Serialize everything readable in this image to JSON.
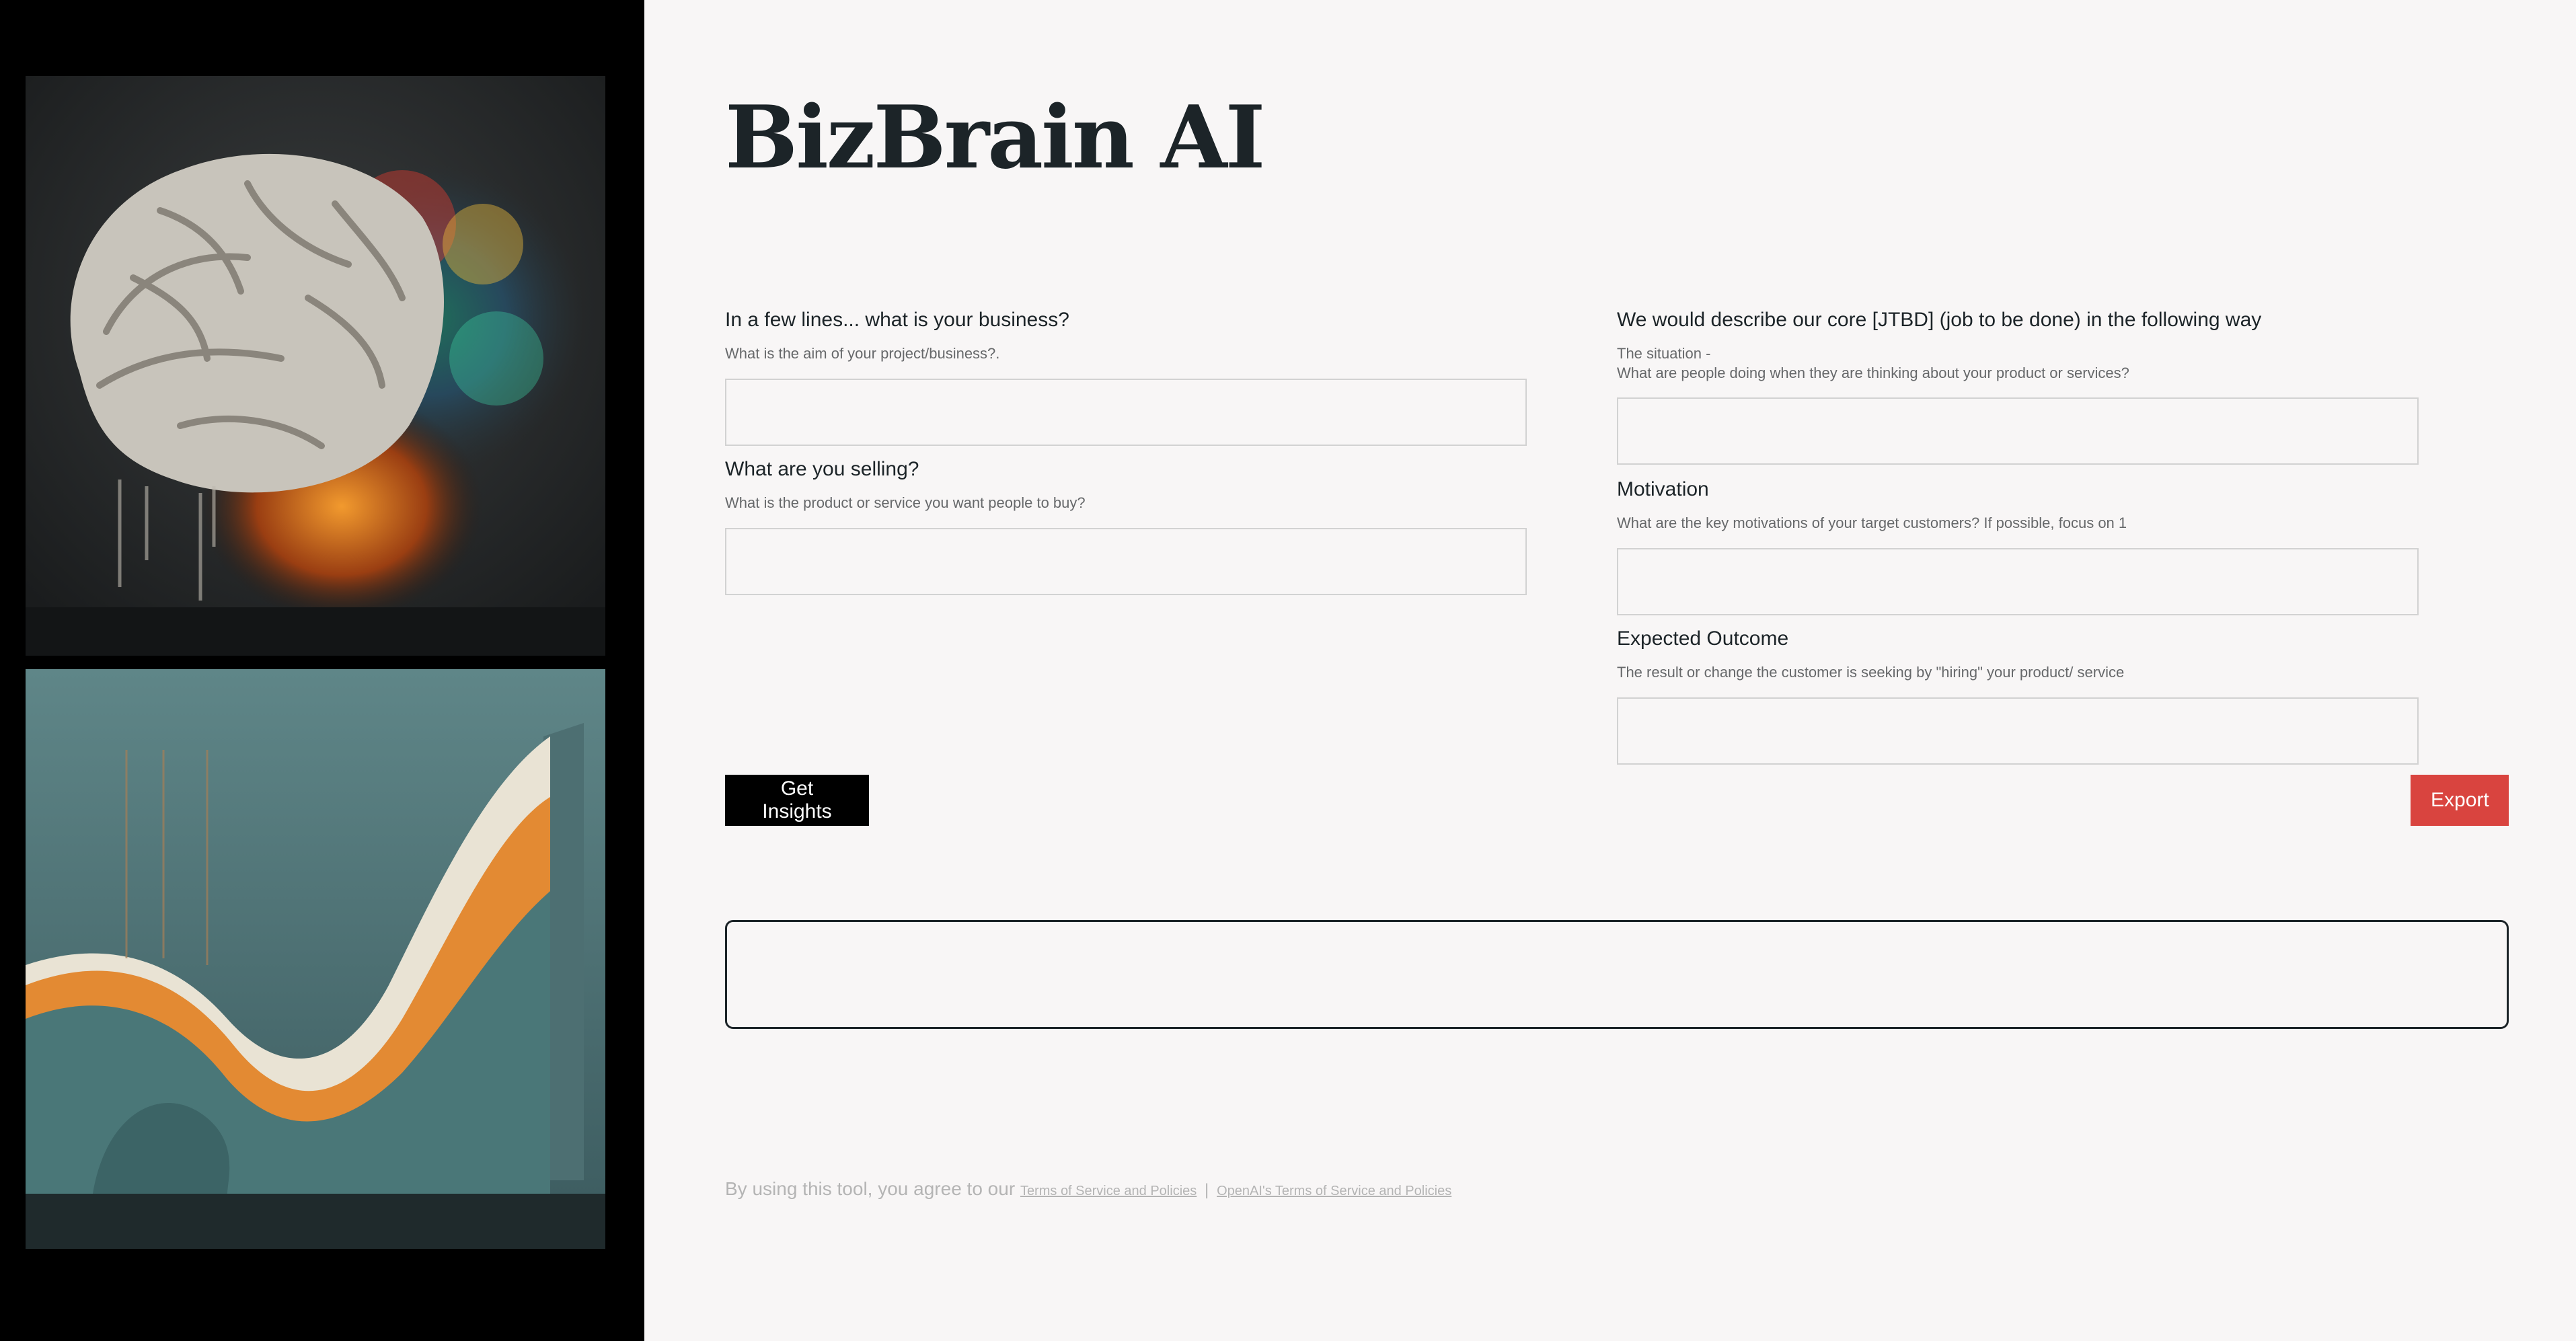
{
  "app": {
    "title": "BizBrain AI"
  },
  "sidebar": {
    "images": [
      {
        "name": "brain-artwork",
        "description": ""
      },
      {
        "name": "wave-artwork",
        "description": ""
      }
    ]
  },
  "form": {
    "left": [
      {
        "label": "In a few lines... what is your business?",
        "help": "What is the aim of your project/business?.",
        "value": "",
        "placeholder": ""
      },
      {
        "label": "What are you selling?",
        "help": "What is the product or service you want people to buy?",
        "value": "",
        "placeholder": ""
      }
    ],
    "right": [
      {
        "label": "We would describe our core [JTBD] (job to be done) in the following way",
        "help_line1": "The situation -",
        "help_line2": "What are people doing when they are thinking about your product or services?",
        "value": "",
        "placeholder": ""
      },
      {
        "label": "Motivation",
        "help": "What are the key motivations of your target customers? If possible, focus on 1",
        "value": "",
        "placeholder": ""
      },
      {
        "label": "Expected Outcome",
        "help": "The result or change the customer is seeking by \"hiring\" your product/ service",
        "value": "",
        "placeholder": ""
      }
    ]
  },
  "actions": {
    "insights_label": "Get Insights",
    "export_label": "Export"
  },
  "output": {
    "text": ""
  },
  "footer": {
    "prefix": "By using this tool, you agree to our",
    "tos_link": "Terms of Service and Policies",
    "separator": "|",
    "openai_link": "OpenAI's Terms of Service and Policies"
  },
  "colors": {
    "accent_export": "#d9443f",
    "primary_button": "#000000",
    "title": "#1c2428",
    "background": "#f8f6f6",
    "sidebar": "#000000"
  }
}
